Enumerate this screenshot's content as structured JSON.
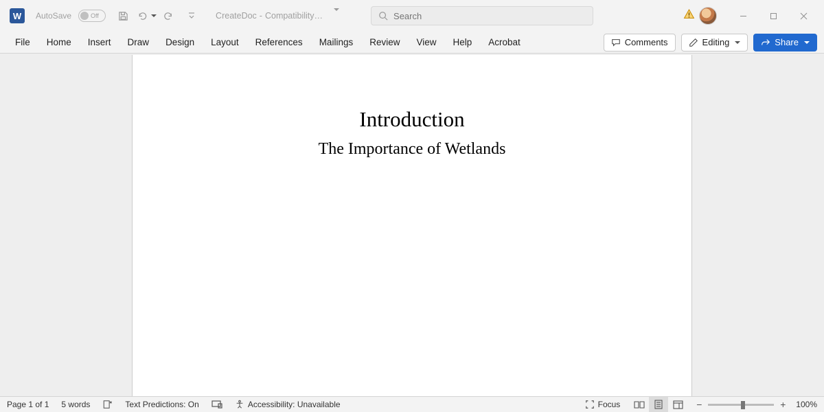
{
  "title_bar": {
    "autosave_label": "AutoSave",
    "autosave_state": "Off",
    "doc_name": "CreateDoc",
    "doc_separator": "-",
    "doc_mode": "Compatibility…",
    "search_placeholder": "Search"
  },
  "ribbon": {
    "tabs": [
      {
        "label": "File"
      },
      {
        "label": "Home"
      },
      {
        "label": "Insert"
      },
      {
        "label": "Draw"
      },
      {
        "label": "Design"
      },
      {
        "label": "Layout"
      },
      {
        "label": "References"
      },
      {
        "label": "Mailings"
      },
      {
        "label": "Review"
      },
      {
        "label": "View"
      },
      {
        "label": "Help"
      },
      {
        "label": "Acrobat"
      }
    ],
    "comments_label": "Comments",
    "editing_label": "Editing",
    "share_label": "Share"
  },
  "document": {
    "heading": "Introduction",
    "subheading": "The Importance of Wetlands"
  },
  "status": {
    "page_info": "Page 1 of 1",
    "word_count": "5 words",
    "text_predictions": "Text Predictions: On",
    "accessibility": "Accessibility: Unavailable",
    "focus_label": "Focus",
    "zoom_percent": "100%"
  },
  "icons": {
    "word_glyph": "W"
  }
}
